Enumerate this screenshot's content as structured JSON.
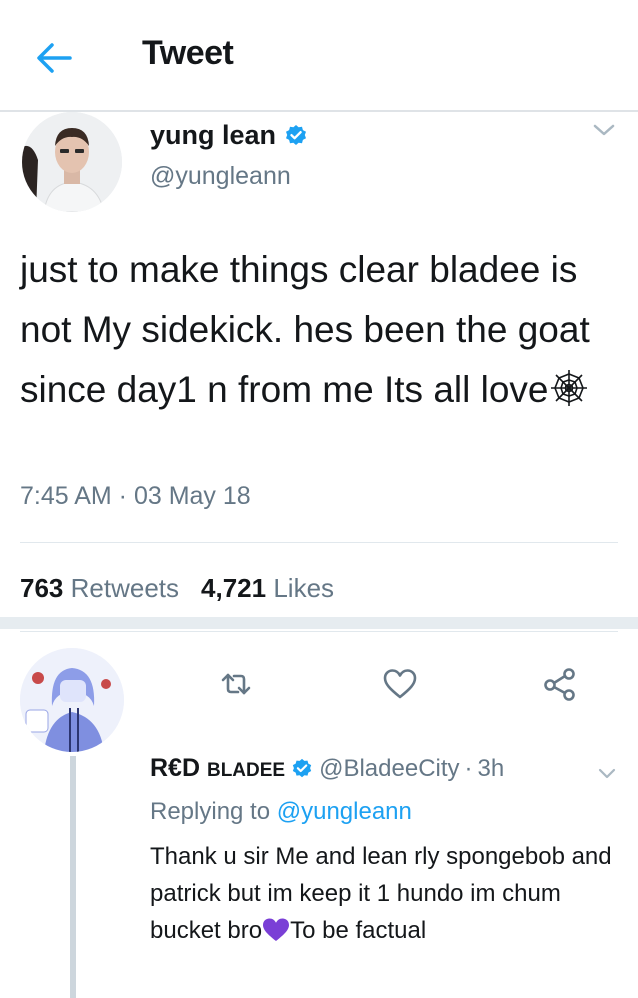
{
  "header": {
    "title": "Tweet",
    "back_icon": "arrow-left-icon"
  },
  "tweet": {
    "author_name": "yung lean",
    "author_handle": "@yungleann",
    "verified": true,
    "text": "just to make things clear bladee is not My sidekick. hes been the goat since day1 n from me Its all love",
    "text_emoji": "spider-web-emoji",
    "timestamp": "7:45 AM · 03 May 18",
    "retweets_count": "763",
    "retweets_label": "Retweets",
    "likes_count": "4,721",
    "likes_label": "Likes",
    "actions": [
      "reply-icon",
      "retweet-icon",
      "like-icon",
      "share-icon"
    ]
  },
  "reply": {
    "author_name_first": "R€D",
    "author_name_second": "BLADEE",
    "verified": true,
    "author_handle": "@BladeeCity",
    "separator": "·",
    "time": "3h",
    "replying_prefix": "Replying to",
    "replying_to": "@yungleann",
    "text_before_emoji": "Thank u sir Me and lean rly spongebob and patrick but im keep it 1 hundo im chum bucket bro",
    "text_emoji": "purple-heart-emoji",
    "text_after_emoji": "To be factual"
  },
  "colors": {
    "accent": "#1da1f2",
    "text": "#14171a",
    "secondary_text": "#657786",
    "divider": "#e1e8ed",
    "purple_heart": "#7a3fd6"
  }
}
